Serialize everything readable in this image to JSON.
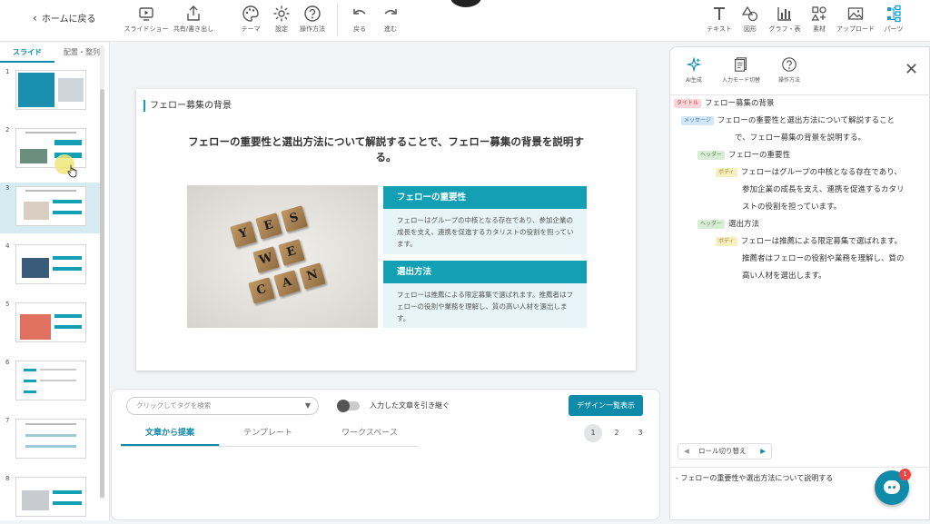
{
  "topbar": {
    "home_label": "ホームに戻る",
    "left_tools": [
      {
        "label": "スライドショー",
        "icon": "play-icon"
      },
      {
        "label": "共有/書き出し",
        "icon": "share-icon"
      },
      {
        "label": "テーマ",
        "icon": "palette-icon"
      },
      {
        "label": "設定",
        "icon": "gear-icon"
      },
      {
        "label": "操作方法",
        "icon": "help-icon"
      },
      {
        "label": "戻る",
        "icon": "undo-icon"
      },
      {
        "label": "進む",
        "icon": "redo-icon"
      }
    ],
    "right_tools": [
      {
        "label": "テキスト",
        "icon": "text-icon"
      },
      {
        "label": "図形",
        "icon": "shape-icon"
      },
      {
        "label": "グラフ・表",
        "icon": "chart-icon"
      },
      {
        "label": "素材",
        "icon": "assets-icon"
      },
      {
        "label": "アップロード",
        "icon": "upload-image-icon"
      },
      {
        "label": "パーツ",
        "icon": "parts-icon"
      }
    ]
  },
  "left_panel": {
    "tabs": [
      "スライド",
      "配置・整列"
    ],
    "slide_numbers": [
      "1",
      "2",
      "3",
      "4",
      "5",
      "6",
      "7",
      "8"
    ],
    "selected": "3"
  },
  "slide": {
    "title": "フェロー募集の背景",
    "message": "フェローの重要性と選出方法について解説することで、フェロー募集の背景を説明する。",
    "sections": [
      {
        "heading": "フェローの重要性",
        "body": "フェローはグループの中核となる存在であり、参加企業の成長を支え、連携を促進するカタリストの役割を担っています。"
      },
      {
        "heading": "選出方法",
        "body": "フェローは推薦による限定募集で選ばれます。推薦者はフェローの役割や業務を理解し、質の高い人材を選出します。"
      }
    ],
    "photo_tiles": [
      "Y",
      "E",
      "S",
      "W",
      "E",
      "C",
      "A",
      "N"
    ]
  },
  "bottom": {
    "tag_search_placeholder": "クリックしてタグを検索",
    "toggle_label": "入力した文章を引き継ぐ",
    "design_button": "デザイン一覧表示",
    "tabs": [
      "文章から提案",
      "テンプレート",
      "ワークスペース"
    ],
    "pages": [
      "1",
      "2",
      "3"
    ]
  },
  "right_panel": {
    "tools": [
      {
        "label": "AI生成",
        "icon": "sparkle-icon"
      },
      {
        "label": "入力モード切替",
        "icon": "document-icon"
      },
      {
        "label": "操作方法",
        "icon": "help-icon"
      }
    ],
    "tags": {
      "title": "タイトル",
      "message": "メッセージ",
      "header": "ヘッダー",
      "body": "ボディ"
    },
    "outline": {
      "title": "フェロー募集の背景",
      "message_line1": "フェローの重要性と選出方法について解説すること",
      "message_line2": "で、フェロー募集の背景を説明する。",
      "header1": "フェローの重要性",
      "body1_line1": "フェローはグループの中核となる存在であり、",
      "body1_line2": "参加企業の成長を支え、連携を促進するカタリ",
      "body1_line3": "ストの役割を担っています。",
      "header2": "選出方法",
      "body2_line1": "フェローは推薦による限定募集で選ばれます。",
      "body2_line2": "推薦者はフェローの役割や業務を理解し、質の",
      "body2_line3": "高い人材を選出します。"
    },
    "role_switch": "ロール切り替え",
    "summary": "- フェローの重要性や選出方法について説明する"
  },
  "chat": {
    "badge": "1"
  },
  "colors": {
    "accent": "#0f8aa8",
    "teal": "#14a0b4",
    "light_teal": "#e7f5f9"
  }
}
